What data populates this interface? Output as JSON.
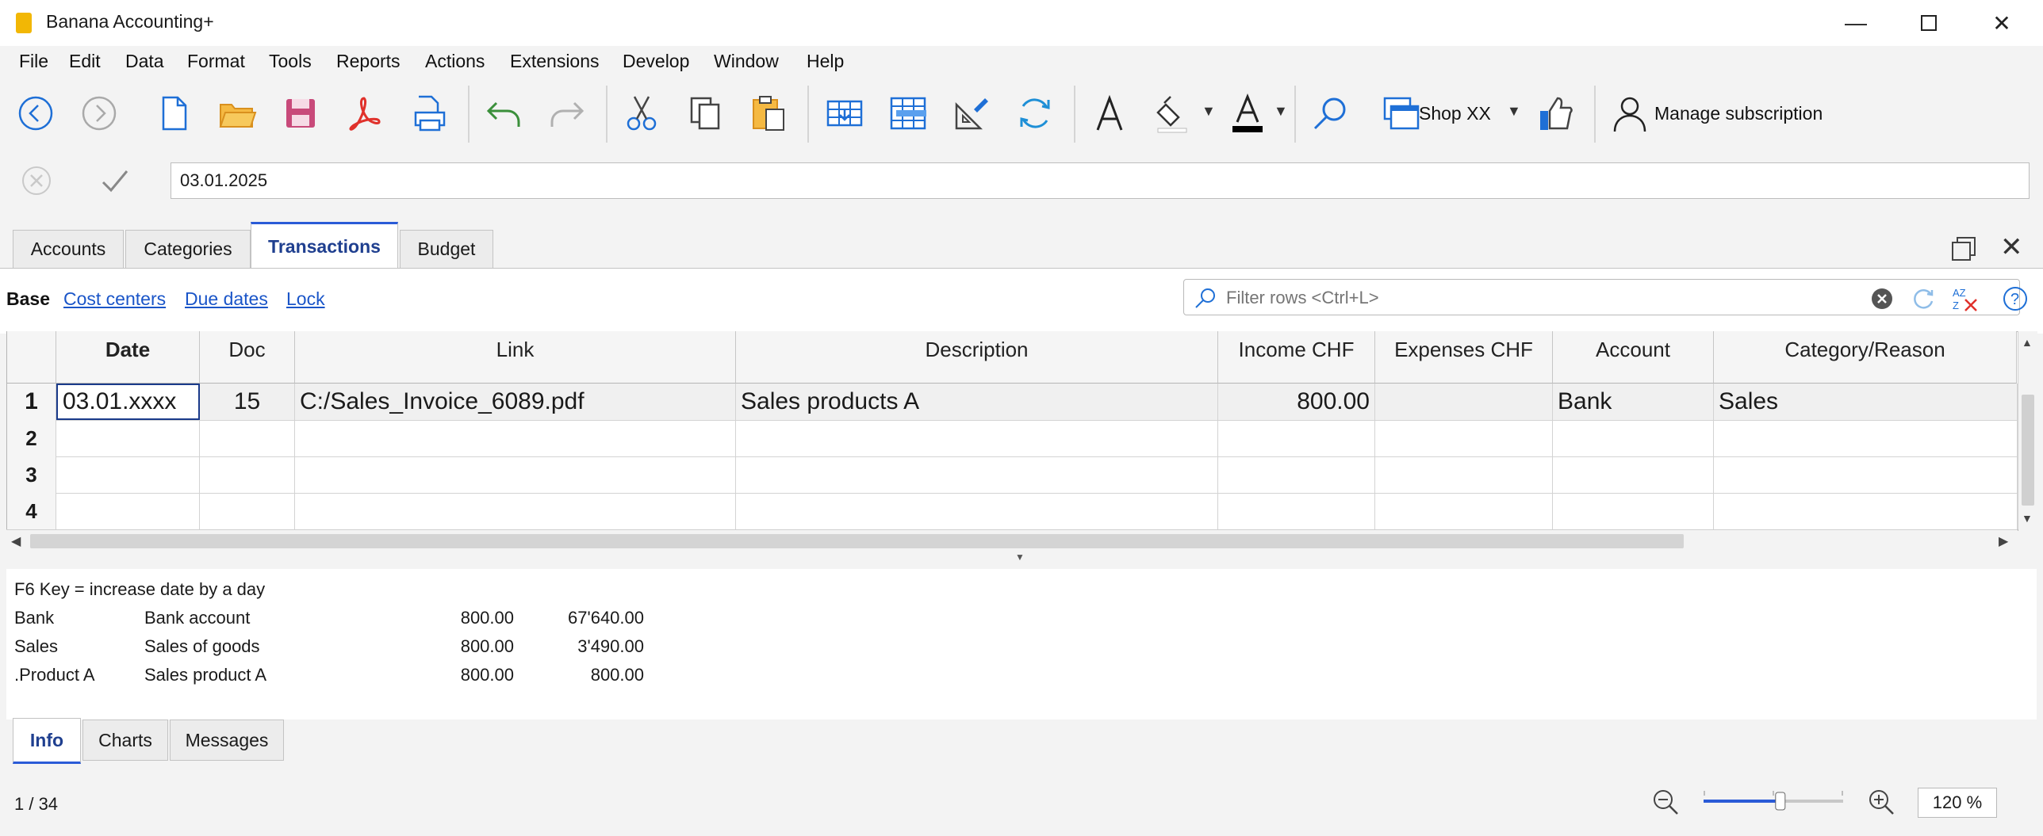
{
  "window": {
    "title": "Banana Accounting+"
  },
  "menu": [
    "File",
    "Edit",
    "Data",
    "Format",
    "Tools",
    "Reports",
    "Actions",
    "Extensions",
    "Develop",
    "Window",
    "Help"
  ],
  "toolbar": {
    "shop_label": "Shop XX",
    "subscription_label": "Manage subscription"
  },
  "editbar": {
    "value": "03.01.2025"
  },
  "tabs": [
    "Accounts",
    "Categories",
    "Transactions",
    "Budget"
  ],
  "active_tab": "Transactions",
  "subviews": {
    "base": "Base",
    "cost_centers": "Cost centers",
    "due_dates": "Due dates",
    "lock": "Lock"
  },
  "filter": {
    "placeholder": "Filter rows <Ctrl+L>"
  },
  "table": {
    "columns": [
      "Date",
      "Doc",
      "Link",
      "Description",
      "Income CHF",
      "Expenses CHF",
      "Account",
      "Category/Reason"
    ],
    "rows": [
      {
        "num": "1",
        "date": "03.01.xxxx",
        "doc": "15",
        "link": "C:/Sales_Invoice_6089.pdf",
        "description": "Sales products A",
        "income": "800.00",
        "expenses": "",
        "account": "Bank",
        "category": "Sales"
      },
      {
        "num": "2",
        "date": "",
        "doc": "",
        "link": "",
        "description": "",
        "income": "",
        "expenses": "",
        "account": "",
        "category": ""
      },
      {
        "num": "3",
        "date": "",
        "doc": "",
        "link": "",
        "description": "",
        "income": "",
        "expenses": "",
        "account": "",
        "category": ""
      },
      {
        "num": "4",
        "date": "",
        "doc": "",
        "link": "",
        "description": "",
        "income": "",
        "expenses": "",
        "account": "",
        "category": ""
      }
    ]
  },
  "info": {
    "hint": "F6 Key = increase date by a day",
    "lines": [
      {
        "code": "Bank",
        "name": "Bank account",
        "amount": "800.00",
        "balance": "67'640.00"
      },
      {
        "code": "Sales",
        "name": "Sales of goods",
        "amount": "800.00",
        "balance": "3'490.00"
      },
      {
        "code": ".Product A",
        "name": "Sales product A",
        "amount": "800.00",
        "balance": "800.00"
      }
    ]
  },
  "bottom_tabs": [
    "Info",
    "Charts",
    "Messages"
  ],
  "status": {
    "position": "1 / 34",
    "zoom": "120 %",
    "zoom_level": 0.55
  },
  "colors": {
    "accent": "#2a5bd7",
    "link": "#1a55c8",
    "app_icon": "#f2b705"
  }
}
